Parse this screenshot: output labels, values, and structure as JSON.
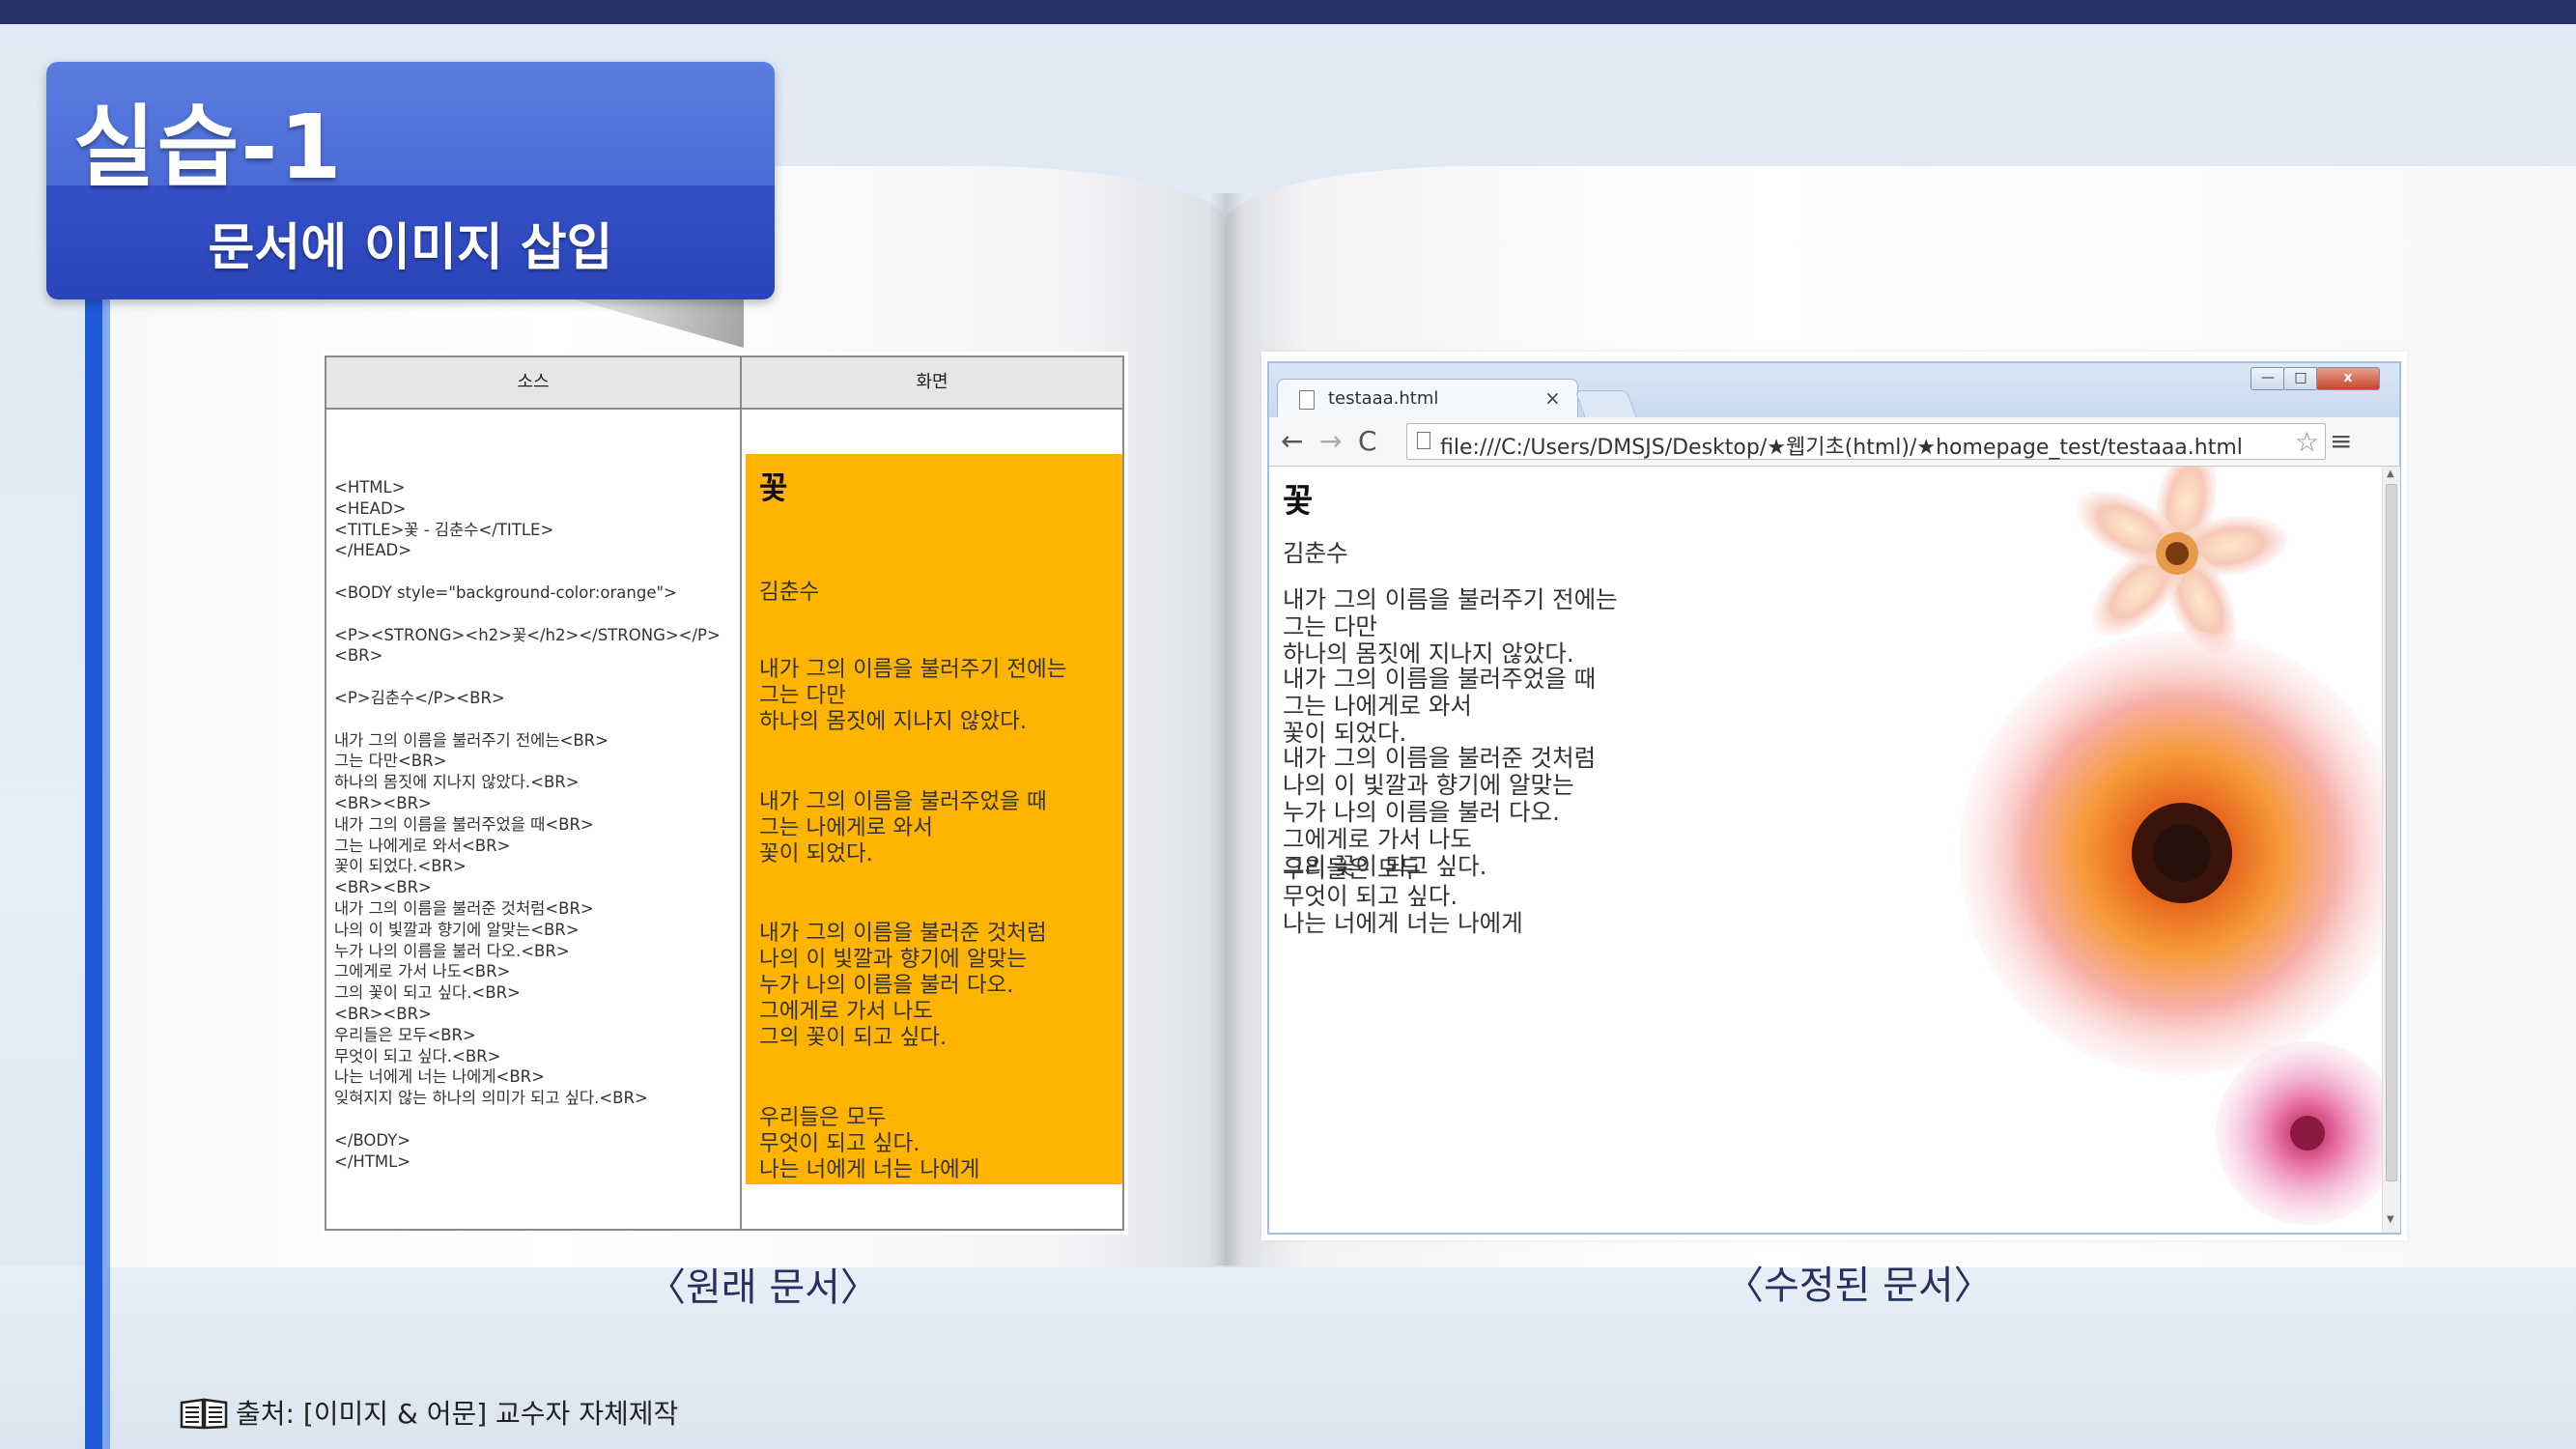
{
  "slide": {
    "title": "실습-1",
    "subtitle": "문서에 이미지 삽입",
    "caption_original": "〈원래 문서〉",
    "caption_modified": "〈수정된 문서〉",
    "source_text": "출처: [이미지 & 어문] 교수자 자체제작"
  },
  "table": {
    "col_source": "소스",
    "col_view": "화면",
    "source_code": "<HTML>\n<HEAD>\n<TITLE>꽃 - 김춘수</TITLE>\n</HEAD>\n\n<BODY style=\"background-color:orange\">\n\n<P><STRONG><h2>꽃</h2></STRONG></P>\n<BR>\n\n<P>김춘수</P><BR>\n\n내가 그의 이름을 불러주기 전에는<BR>\n그는 다만<BR>\n하나의 몸짓에 지나지 않았다.<BR>\n<BR><BR>\n내가 그의 이름을 불러주었을 때<BR>\n그는 나에게로 와서<BR>\n꽃이 되었다.<BR>\n<BR><BR>\n내가 그의 이름을 불러준 것처럼<BR>\n나의 이 빛깔과 향기에 알맞는<BR>\n누가 나의 이름을 불러 다오.<BR>\n그에게로 가서 나도<BR>\n그의 꽃이 되고 싶다.<BR>\n<BR><BR>\n우리들은 모두<BR>\n무엇이 되고 싶다.<BR>\n나는 너에게 너는 나에게<BR>\n잊혀지지 않는 하나의 의미가 되고 싶다.<BR>\n\n</BODY>\n</HTML>",
    "view_heading": "꽃",
    "view_author": "김춘수",
    "view_p1": "내가 그의 이름을 불러주기 전에는\n그는 다만\n하나의 몸짓에 지나지 않았다.",
    "view_p2": "내가 그의 이름을 불러주었을 때\n그는 나에게로 와서\n꽃이 되었다.",
    "view_p3": "내가 그의 이름을 불러준 것처럼\n나의 이 빛깔과 향기에 알맞는\n누가 나의 이름을 불러 다오.\n그에게로 가서 나도\n그의 꽃이 되고 싶다.",
    "view_p4": "우리들은 모두\n무엇이 되고 싶다.\n나는 너에게 너는 나에게"
  },
  "browser": {
    "tab_title": "testaaa.html",
    "tab_close": "×",
    "url": "file:///C:/Users/DMSJS/Desktop/★웹기초(html)/★homepage_test/testaaa.html",
    "btn_back": "←",
    "btn_forward": "→",
    "btn_reload": "C",
    "btn_star": "☆",
    "btn_menu": "≡",
    "win_min": "—",
    "win_max": "□",
    "win_close": "x",
    "page_heading": "꽃",
    "page_author": "김춘수",
    "page_p1": "내가 그의 이름을 불러주기 전에는\n그는 다만\n하나의 몸짓에 지나지 않았다.",
    "page_p2": "내가 그의 이름을 불러주었을 때\n그는 나에게로 와서\n꽃이 되었다.",
    "page_p3": "내가 그의 이름을 불러준 것처럼\n나의 이 빛깔과 향기에 알맞는\n누가 나의 이름을 불러 다오.\n그에게로 가서 나도\n그의 꽃이 되고 싶다.",
    "page_p4": "우리들은 모두\n무엇이 되고 싶다.\n나는 너에게 너는 나에게"
  },
  "colors": {
    "topbar": "#27336b",
    "badge_top": "#5b7ee0",
    "badge_bottom": "#2a45b8",
    "orange_bg": "#ffb400",
    "caption_text": "#24325e"
  }
}
